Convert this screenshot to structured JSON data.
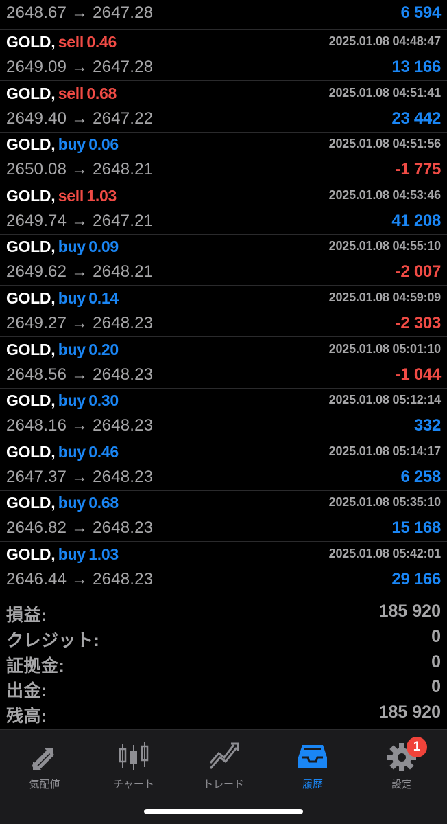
{
  "top_partial": {
    "prices": "2648.67 → 2647.28",
    "profit": "6 594",
    "profit_sign": "pos"
  },
  "trades": [
    {
      "symbol": "GOLD,",
      "side": "sell",
      "lots": "0.46",
      "time": "2025.01.08 04:48:47",
      "prices": "2649.09 → 2647.28",
      "profit": "13 166",
      "profit_sign": "pos"
    },
    {
      "symbol": "GOLD,",
      "side": "sell",
      "lots": "0.68",
      "time": "2025.01.08 04:51:41",
      "prices": "2649.40 → 2647.22",
      "profit": "23 442",
      "profit_sign": "pos"
    },
    {
      "symbol": "GOLD,",
      "side": "buy",
      "lots": "0.06",
      "time": "2025.01.08 04:51:56",
      "prices": "2650.08 → 2648.21",
      "profit": "-1 775",
      "profit_sign": "neg"
    },
    {
      "symbol": "GOLD,",
      "side": "sell",
      "lots": "1.03",
      "time": "2025.01.08 04:53:46",
      "prices": "2649.74 → 2647.21",
      "profit": "41 208",
      "profit_sign": "pos"
    },
    {
      "symbol": "GOLD,",
      "side": "buy",
      "lots": "0.09",
      "time": "2025.01.08 04:55:10",
      "prices": "2649.62 → 2648.21",
      "profit": "-2 007",
      "profit_sign": "neg"
    },
    {
      "symbol": "GOLD,",
      "side": "buy",
      "lots": "0.14",
      "time": "2025.01.08 04:59:09",
      "prices": "2649.27 → 2648.23",
      "profit": "-2 303",
      "profit_sign": "neg"
    },
    {
      "symbol": "GOLD,",
      "side": "buy",
      "lots": "0.20",
      "time": "2025.01.08 05:01:10",
      "prices": "2648.56 → 2648.23",
      "profit": "-1 044",
      "profit_sign": "neg"
    },
    {
      "symbol": "GOLD,",
      "side": "buy",
      "lots": "0.30",
      "time": "2025.01.08 05:12:14",
      "prices": "2648.16 → 2648.23",
      "profit": "332",
      "profit_sign": "pos"
    },
    {
      "symbol": "GOLD,",
      "side": "buy",
      "lots": "0.46",
      "time": "2025.01.08 05:14:17",
      "prices": "2647.37 → 2648.23",
      "profit": "6 258",
      "profit_sign": "pos"
    },
    {
      "symbol": "GOLD,",
      "side": "buy",
      "lots": "0.68",
      "time": "2025.01.08 05:35:10",
      "prices": "2646.82 → 2648.23",
      "profit": "15 168",
      "profit_sign": "pos"
    },
    {
      "symbol": "GOLD,",
      "side": "buy",
      "lots": "1.03",
      "time": "2025.01.08 05:42:01",
      "prices": "2646.44 → 2648.23",
      "profit": "29 166",
      "profit_sign": "pos"
    }
  ],
  "summary": [
    {
      "label": "損益:",
      "value": "185 920"
    },
    {
      "label": "クレジット:",
      "value": "0"
    },
    {
      "label": "証拠金:",
      "value": "0"
    },
    {
      "label": "出金:",
      "value": "0"
    },
    {
      "label": "残高:",
      "value": "185 920"
    }
  ],
  "tabbar": {
    "tabs": [
      {
        "label": "気配値",
        "icon": "quotes-arrows-icon",
        "active": false
      },
      {
        "label": "チャート",
        "icon": "candlestick-chart-icon",
        "active": false
      },
      {
        "label": "トレード",
        "icon": "trade-chart-icon",
        "active": false
      },
      {
        "label": "履歴",
        "icon": "history-inbox-icon",
        "active": true
      },
      {
        "label": "設定",
        "icon": "gear-icon",
        "active": false,
        "badge": "1"
      }
    ]
  },
  "colors": {
    "buy": "#1a86f5",
    "sell": "#f04b45",
    "muted": "#a6a6a8",
    "active_tab": "#1a86f5",
    "inactive_tab": "#8e8e93",
    "badge": "#f0433a"
  }
}
